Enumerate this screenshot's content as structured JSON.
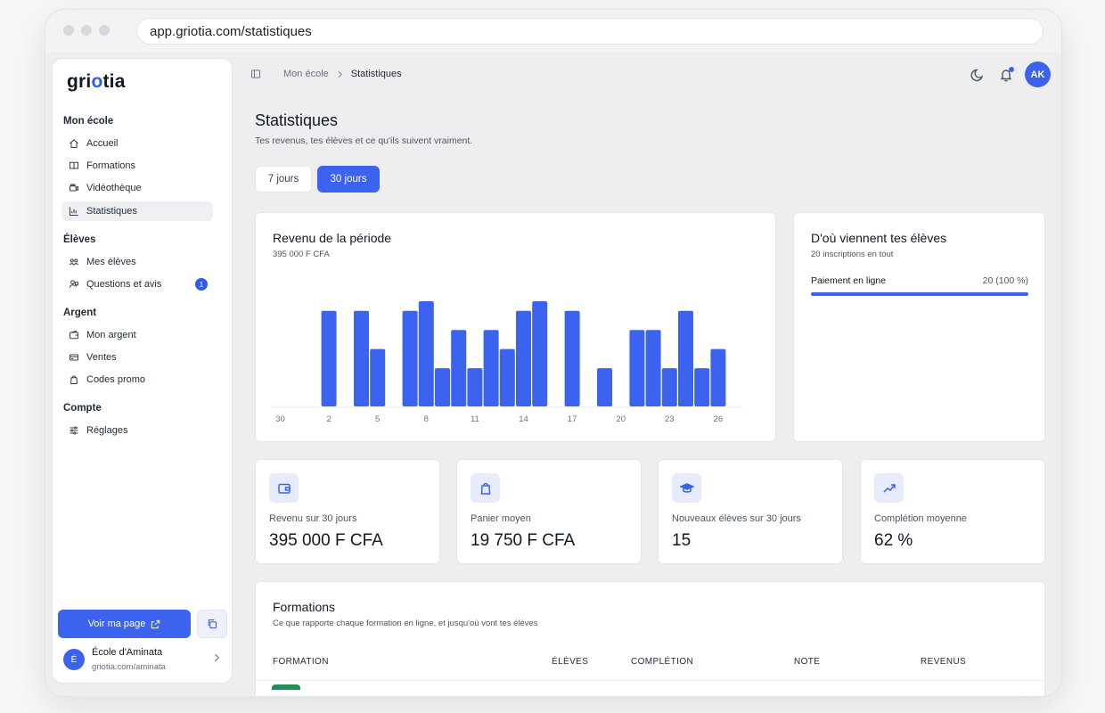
{
  "browser": {
    "url": "app.griotia.com/statistiques"
  },
  "sidebar": {
    "logo_pre": "gri",
    "logo_o": "o",
    "logo_post": "tia",
    "sections": [
      {
        "title": "Mon école",
        "items": [
          {
            "label": "Accueil",
            "icon": "home-icon"
          },
          {
            "label": "Formations",
            "icon": "book-icon"
          },
          {
            "label": "Vidéothèque",
            "icon": "video-icon"
          },
          {
            "label": "Statistiques",
            "icon": "bar-chart-icon",
            "active": true
          }
        ]
      },
      {
        "title": "Élèves",
        "items": [
          {
            "label": "Mes élèves",
            "icon": "users-icon"
          },
          {
            "label": "Questions et avis",
            "icon": "chat-icon",
            "badge": "1"
          }
        ]
      },
      {
        "title": "Argent",
        "items": [
          {
            "label": "Mon argent",
            "icon": "wallet-icon"
          },
          {
            "label": "Ventes",
            "icon": "card-icon"
          },
          {
            "label": "Codes promo",
            "icon": "tag-icon"
          }
        ]
      },
      {
        "title": "Compte",
        "items": [
          {
            "label": "Réglages",
            "icon": "sliders-icon"
          }
        ]
      }
    ],
    "view_page_label": "Voir ma page",
    "school": {
      "initial": "É",
      "name": "École d'Aminata",
      "url": "griotia.com/aminata"
    }
  },
  "topbar": {
    "breadcrumb": [
      "Mon école",
      "Statistiques"
    ],
    "avatar_initials": "AK"
  },
  "page": {
    "title": "Statistiques",
    "subtitle": "Tes revenus, tes élèves et ce qu'ils suivent vraiment.",
    "period_tabs": [
      "7 jours",
      "30 jours"
    ],
    "active_period": "30 jours"
  },
  "revenue_card": {
    "title": "Revenu de la période",
    "total": "395 000 F CFA"
  },
  "sources_card": {
    "title": "D'où viennent tes élèves",
    "subtitle": "20 inscriptions en tout",
    "rows": [
      {
        "label": "Paiement en ligne",
        "value": "20 (100 %)",
        "fraction": 1.0
      }
    ]
  },
  "kpis": [
    {
      "label": "Revenu sur 30 jours",
      "value": "395 000 F CFA",
      "icon": "wallet-icon"
    },
    {
      "label": "Panier moyen",
      "value": "19 750 F CFA",
      "icon": "shopping-bag-icon"
    },
    {
      "label": "Nouveaux élèves sur 30 jours",
      "value": "15",
      "icon": "graduation-cap-icon"
    },
    {
      "label": "Complétion moyenne",
      "value": "62 %",
      "icon": "trending-up-icon"
    }
  ],
  "formations_card": {
    "title": "Formations",
    "subtitle": "Ce que rapporte chaque formation en ligne, et jusqu'où vont tes élèves",
    "columns": [
      "FORMATION",
      "ÉLÈVES",
      "COMPLÉTION",
      "NOTE",
      "REVENUS"
    ]
  },
  "chart_data": {
    "type": "bar",
    "categories": [
      "30",
      "31",
      "1",
      "2",
      "3",
      "4",
      "5",
      "6",
      "7",
      "8",
      "9",
      "10",
      "11",
      "12",
      "13",
      "14",
      "15",
      "16",
      "17",
      "18",
      "19",
      "20",
      "21",
      "22",
      "23",
      "24",
      "25",
      "26",
      "27"
    ],
    "tick_labels": [
      "30",
      "2",
      "5",
      "8",
      "11",
      "14",
      "17",
      "20",
      "23",
      "26"
    ],
    "values": [
      0,
      0,
      0,
      5,
      0,
      5,
      3,
      0,
      5,
      5.5,
      2,
      4,
      2,
      4,
      3,
      5,
      5.5,
      0,
      5,
      0,
      2,
      0,
      4,
      4,
      2,
      5,
      2,
      3,
      0
    ],
    "ylim": [
      0,
      5.5
    ],
    "color": "#3b63f0",
    "grid": false
  }
}
